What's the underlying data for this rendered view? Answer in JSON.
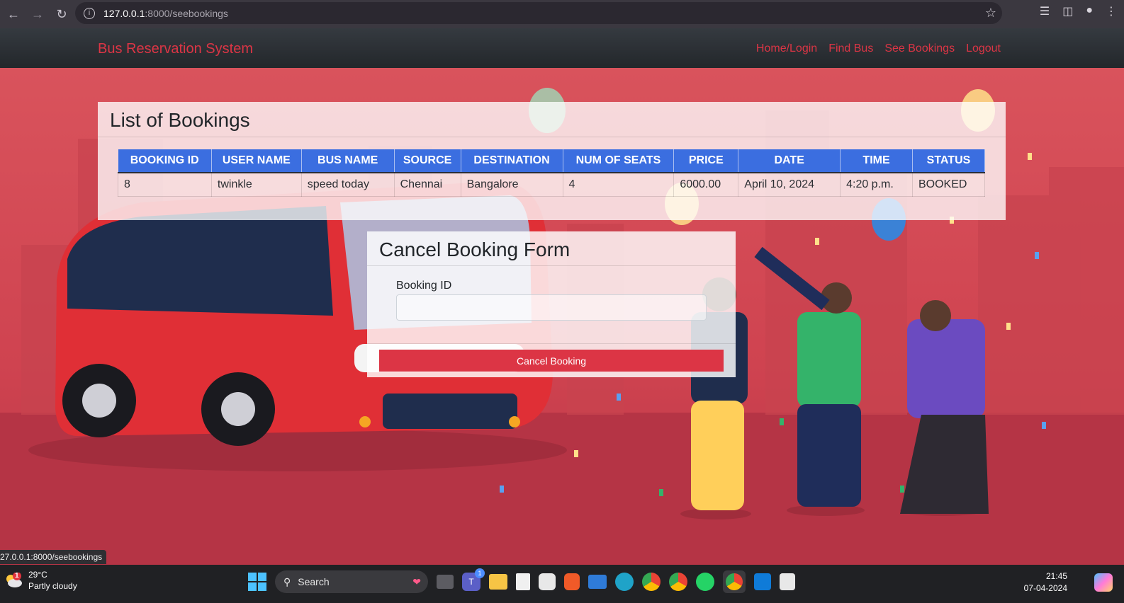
{
  "browser": {
    "url_host": "127.0.0.1",
    "url_path": ":8000/seebookings"
  },
  "navbar": {
    "brand": "Bus Reservation System",
    "links": [
      "Home/Login",
      "Find Bus",
      "See Bookings",
      "Logout"
    ]
  },
  "bookings": {
    "title": "List of Bookings",
    "columns": [
      "BOOKING ID",
      "USER NAME",
      "BUS NAME",
      "SOURCE",
      "DESTINATION",
      "NUM OF SEATS",
      "PRICE",
      "DATE",
      "TIME",
      "STATUS"
    ],
    "rows": [
      [
        "8",
        "twinkle",
        "speed today",
        "Chennai",
        "Bangalore",
        "4",
        "6000.00",
        "April 10, 2024",
        "4:20 p.m.",
        "BOOKED"
      ]
    ]
  },
  "cancel_form": {
    "title": "Cancel Booking Form",
    "field_label": "Booking ID",
    "field_value": "",
    "button_label": "Cancel Booking"
  },
  "status_bar": {
    "hover_url": "27.0.0.1:8000/seebookings"
  },
  "taskbar": {
    "weather_temp": "29°C",
    "weather_desc": "Partly cloudy",
    "weather_badge": "1",
    "search_label": "Search",
    "teams_badge": "1",
    "time": "21:45",
    "date": "07-04-2024"
  },
  "colors": {
    "accent_red": "#dc3545",
    "table_header_blue": "#3b6ee0",
    "navbar_dark": "#23272b"
  }
}
